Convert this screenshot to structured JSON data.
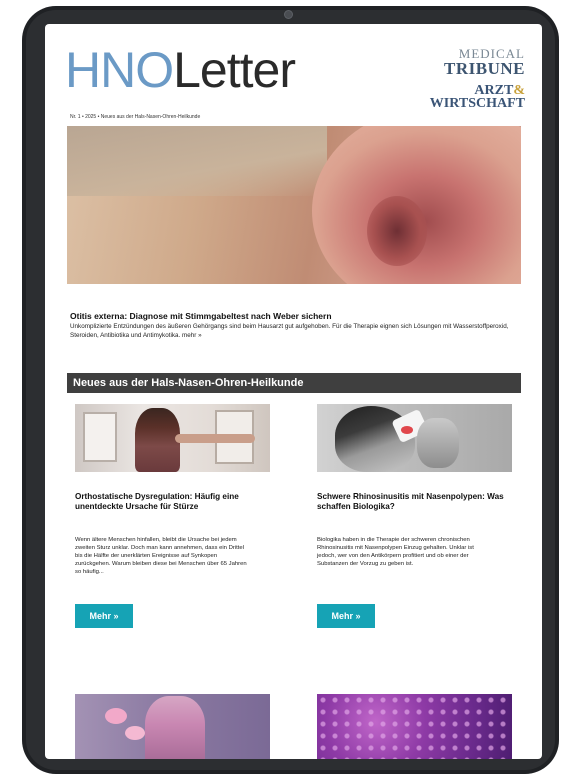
{
  "masthead": {
    "part1": "HNO",
    "part2": "Letter"
  },
  "brands": {
    "medical_tribune": {
      "line1": "MEDICAL",
      "line2": "TRIBUNE"
    },
    "arzt_wirtschaft": {
      "line1": "ARZT",
      "amp": "&",
      "line2": "WIRTSCHAFT"
    }
  },
  "issue_line": "Nr. 1 • 2025 • Neues aus der Hals-Nasen-Ohren-Heilkunde",
  "lead": {
    "title": "Otitis externa: Diagnose mit Stimmgabeltest nach Weber sichern",
    "text": "Unkomplizierte Entzündungen des äußeren Gehörgangs sind beim Hausarzt gut aufgehoben. Für die Therapie eignen sich Lösungen mit Wasserstoffperoxid, Steroiden, Antibiotika und Antimykotika.",
    "more": "mehr »"
  },
  "section": {
    "title": "Neues aus der Hals-Nasen-Ohren-Heilkunde"
  },
  "cards": [
    {
      "title": "Orthostatische Dysregulation: Häufig eine unentdeckte Ursache für Stürze",
      "body": "Wenn ältere Menschen hinfallen, bleibt die Ursache bei jedem zweiten Sturz unklar. Doch man kann annehmen, dass ein Drittel bis die Hälfte der unerklärten Ereignisse auf Synkopen zurückgehen. Warum bleiben diese bei Menschen über 65 Jahren so häufig...",
      "button": "Mehr »"
    },
    {
      "title": "Schwere Rhinosinusitis mit Nasenpolypen: Was schaffen Biologika?",
      "body": "Biologika haben in die Therapie der schweren chronischen Rhinosinusitis mit Nasenpolypen Einzug gehalten. Unklar ist jedoch, wer von den Antikörpern profitiert und ob einer der Substanzen der Vorzug zu geben ist.",
      "button": "Mehr »"
    }
  ],
  "colors": {
    "accent": "#16a3b5",
    "section_bar": "#3f3f3f",
    "masthead_blue": "#6b9ac6"
  }
}
